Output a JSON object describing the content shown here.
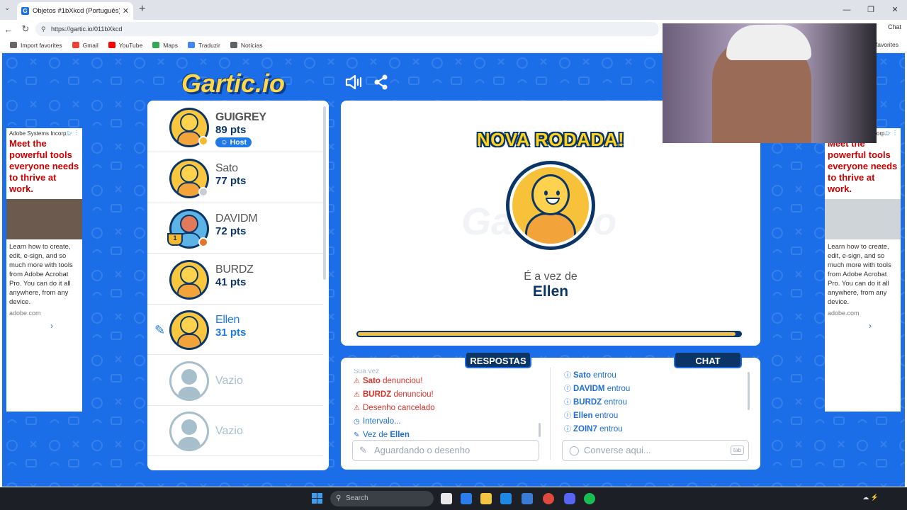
{
  "browser": {
    "tab_title": "Objetos #1bXkcd (Português)",
    "url": "https://gartic.io/011bXkcd",
    "chat_label": "Chat",
    "other_favorites": "favorites",
    "bookmarks": [
      {
        "label": "Import favorites",
        "color": "#666"
      },
      {
        "label": "Gmail",
        "color": "#ea4335"
      },
      {
        "label": "YouTube",
        "color": "#ff0000"
      },
      {
        "label": "Maps",
        "color": "#34a853"
      },
      {
        "label": "Traduzir",
        "color": "#4285f4"
      },
      {
        "label": "Notícias",
        "color": "#5f6368"
      }
    ]
  },
  "game": {
    "logo_main": "Gartic",
    "logo_suffix": ".io",
    "players": [
      {
        "name": "GUIGREY",
        "points": "89 pts",
        "badge": "Host",
        "status_color": "#f5b82e"
      },
      {
        "name": "Sato",
        "points": "77 pts",
        "status_color": "#c9ccd2"
      },
      {
        "name": "DAVIDM",
        "points": "72 pts",
        "status_color": "#e0782a",
        "trophy": "1"
      },
      {
        "name": "BURDZ",
        "points": "41 pts"
      },
      {
        "name": "Ellen",
        "points": "31 pts",
        "drawing": true
      },
      {
        "name": "Vazio"
      },
      {
        "name": "Vazio"
      }
    ],
    "round": {
      "title": "NOVA RODADA!",
      "turn_label": "É a vez de",
      "turn_player": "Ellen",
      "timer_fraction": 0.98
    },
    "answers": {
      "tab": "RESPOSTAS",
      "faded_row": "Sua vez",
      "rows": [
        {
          "icon": "⚠",
          "name": "Sato",
          "text": " denunciou!",
          "color": "red"
        },
        {
          "icon": "⚠",
          "name": "BURDZ",
          "text": " denunciou!",
          "color": "red"
        },
        {
          "icon": "⚠",
          "name": "",
          "text": "Desenho cancelado",
          "color": "red"
        },
        {
          "icon": "◷",
          "name": "",
          "text": "Intervalo...",
          "color": "blue"
        },
        {
          "icon": "✎",
          "name": "",
          "text": "Vez de ",
          "name2": "Ellen",
          "color": "blue"
        }
      ],
      "placeholder": "Aguardando o desenho"
    },
    "chat": {
      "tab": "CHAT",
      "rows": [
        {
          "name": "Sato",
          "text": " entrou"
        },
        {
          "name": "DAVIDM",
          "text": " entrou"
        },
        {
          "name": "BURDZ",
          "text": " entrou"
        },
        {
          "name": "Ellen",
          "text": " entrou"
        },
        {
          "name": "ZOIN7",
          "text": " entrou"
        }
      ],
      "placeholder": "Converse aqui...",
      "key_hint": "tab"
    }
  },
  "ads": {
    "left": {
      "source": "Adobe Systems Incorp...",
      "headline": "Meet the powerful tools everyone needs to thrive at work.",
      "body": "Learn how to create, edit, e-sign, and so much more with tools from Adobe Acrobat Pro. You can do it all anywhere, from any device.",
      "domain": "adobe.com"
    },
    "right": {
      "source": "Adobe Systems Incorp...",
      "headline": "Meet the powerful tools everyone needs to thrive at work.",
      "body": "Learn how to create, edit, e-sign, and so much more with tools from Adobe Acrobat Pro. You can do it all anywhere, from any device.",
      "domain": "adobe.com"
    }
  },
  "taskbar": {
    "search_placeholder": "Search"
  }
}
